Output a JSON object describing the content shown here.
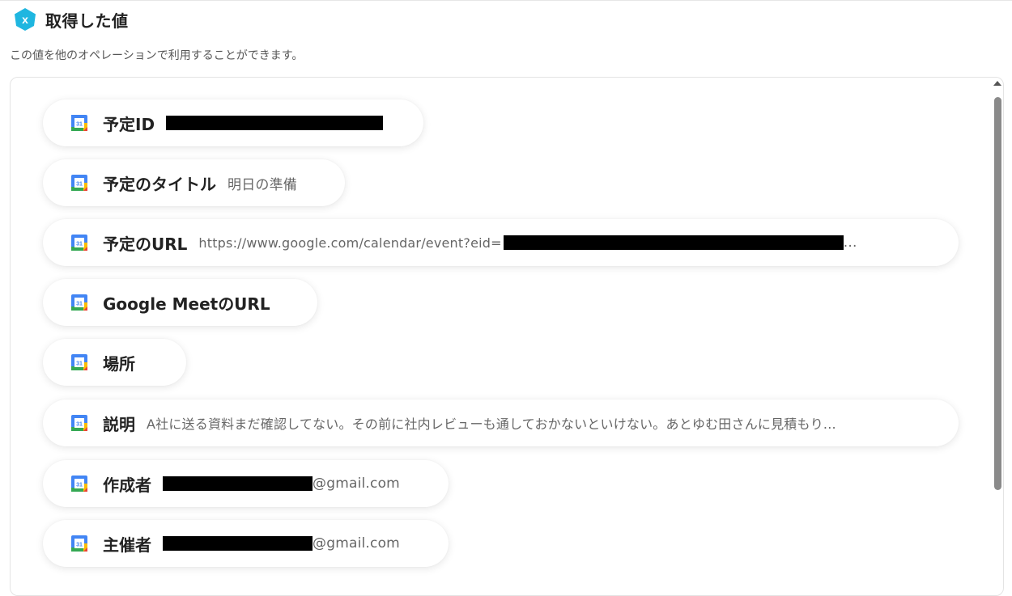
{
  "header": {
    "logo_icon": "yoom-logo-icon",
    "title": "取得した値"
  },
  "subtitle": "この値を他のオペレーションで利用することができます。",
  "colors": {
    "logo": "#1fb6e0",
    "text": "#222222",
    "muted": "#666666",
    "redaction": "#000000"
  },
  "items": [
    {
      "label": "予定ID",
      "value": "",
      "redacted": true
    },
    {
      "label": "予定のタイトル",
      "value": "明日の準備"
    },
    {
      "label": "予定のURL",
      "value_prefix": "https://www.google.com/calendar/event?eid=",
      "value_suffix": "...",
      "redacted": true
    },
    {
      "label": "Google MeetのURL",
      "value": ""
    },
    {
      "label": "場所",
      "value": ""
    },
    {
      "label": "説明",
      "value": "A社に送る資料まだ確認してない。その前に社内レビューも通しておかないといけない。あとゆむ田さんに見積もり..."
    },
    {
      "label": "作成者",
      "value_suffix": "@gmail.com",
      "redacted": true
    },
    {
      "label": "主催者",
      "value_suffix": "@gmail.com",
      "redacted": true
    }
  ],
  "item_icon": "google-calendar-icon"
}
